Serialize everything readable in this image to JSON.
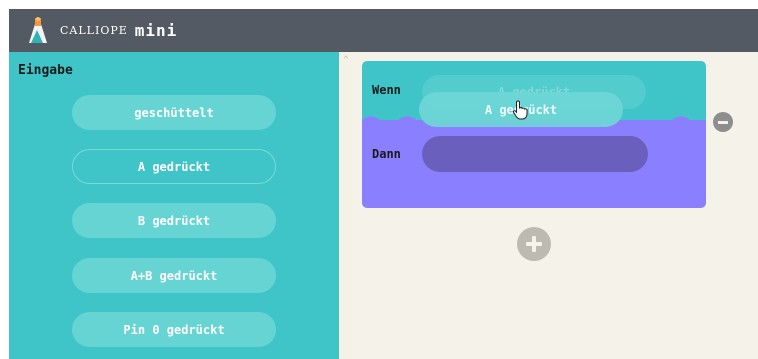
{
  "app": {
    "brand_name": "CALLIOPE",
    "brand_mini": "mini"
  },
  "palette": {
    "title": "Eingabe",
    "items": [
      {
        "label": "geschüttelt"
      },
      {
        "label": "A gedrückt"
      },
      {
        "label": "B gedrückt"
      },
      {
        "label": "A+B gedrückt"
      },
      {
        "label": "Pin 0 gedrückt"
      }
    ]
  },
  "rule": {
    "when_label": "Wenn",
    "then_label": "Dann",
    "when_placeholder": "A gedrückt"
  },
  "drag": {
    "label": "A gedrückt"
  },
  "colors": {
    "titlebar": "#535a63",
    "palette_bg": "#3fc5c7",
    "palette_item": "#67d4d4",
    "workspace_bg": "#f5f2e9",
    "when_bg": "#3fc5c7",
    "then_bg": "#8a80ff",
    "then_slot": "#6a5fbd"
  },
  "icons": {
    "logo": "calliope-logo-icon",
    "remove": "minus-circle-icon",
    "add": "plus-circle-icon",
    "cursor": "hand-pointer-icon",
    "scroll": "chevron-up-icon"
  }
}
